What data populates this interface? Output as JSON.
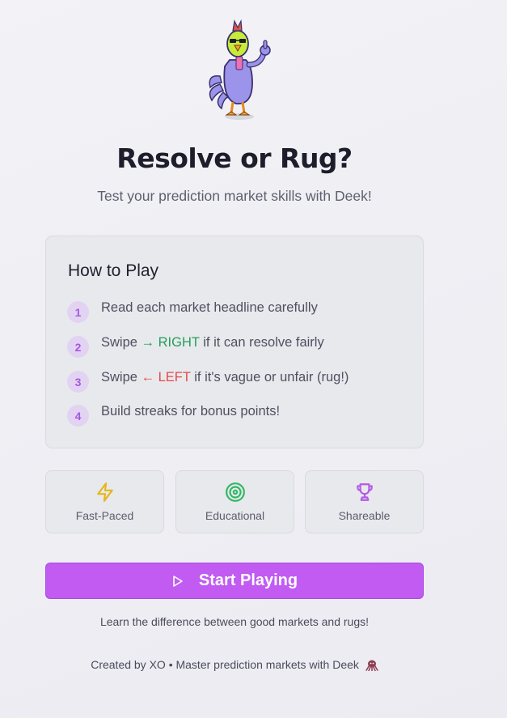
{
  "header": {
    "title": "Resolve or Rug?",
    "subtitle": "Test your prediction market skills with Deek!"
  },
  "mascot": {
    "icon": "rooster-mascot-icon"
  },
  "how_to_play": {
    "heading": "How to Play",
    "steps": [
      {
        "number": "1",
        "text": "Read each market headline carefully"
      },
      {
        "number": "2",
        "prefix": "Swipe ",
        "arrow": "→ RIGHT",
        "suffix": " if it can resolve fairly",
        "arrow_color": "#22a05a"
      },
      {
        "number": "3",
        "prefix": "Swipe ",
        "arrow": "← LEFT",
        "suffix": " if it's vague or unfair (rug!)",
        "arrow_color": "#e34a4a"
      },
      {
        "number": "4",
        "text": "Build streaks for bonus points!"
      }
    ]
  },
  "features": [
    {
      "label": "Fast-Paced",
      "icon": "lightning-icon",
      "color": "#e7b51c"
    },
    {
      "label": "Educational",
      "icon": "target-icon",
      "color": "#2fb864"
    },
    {
      "label": "Shareable",
      "icon": "trophy-icon",
      "color": "#b55be4"
    }
  ],
  "start_button": {
    "label": "Start Playing",
    "icon": "play-icon",
    "color": "#c15bf2"
  },
  "tagline": "Learn the difference between good markets and rugs!",
  "footer": {
    "text": "Created by XO • Master prediction markets with Deek",
    "icon": "octopus-icon"
  }
}
